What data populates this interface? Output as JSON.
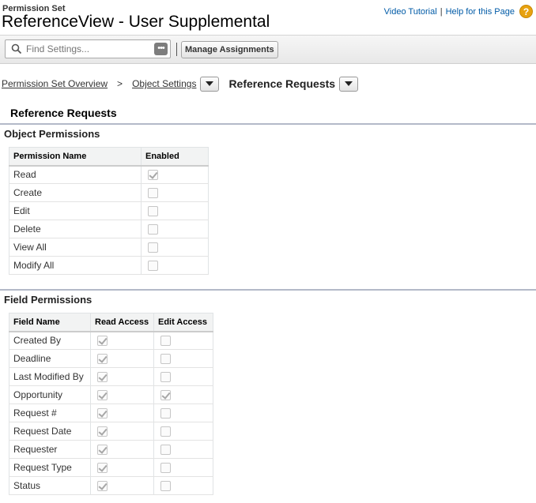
{
  "header": {
    "eyebrow": "Permission Set",
    "title": "ReferenceView - User Supplemental",
    "video_tutorial": "Video Tutorial",
    "separator": "|",
    "help_page": "Help for this Page",
    "help_icon": "question-icon"
  },
  "toolbar": {
    "search_placeholder": "Find Settings...",
    "manage_assignments": "Manage Assignments"
  },
  "breadcrumb": {
    "overview": "Permission Set Overview",
    "sep": ">",
    "object_settings": "Object Settings",
    "current": "Reference Requests"
  },
  "page_heading": "Reference Requests",
  "object_permissions": {
    "title": "Object Permissions",
    "columns": [
      "Permission Name",
      "Enabled"
    ],
    "rows": [
      {
        "name": "Read",
        "enabled": true
      },
      {
        "name": "Create",
        "enabled": false
      },
      {
        "name": "Edit",
        "enabled": false
      },
      {
        "name": "Delete",
        "enabled": false
      },
      {
        "name": "View All",
        "enabled": false
      },
      {
        "name": "Modify All",
        "enabled": false
      }
    ]
  },
  "field_permissions": {
    "title": "Field Permissions",
    "columns": [
      "Field Name",
      "Read Access",
      "Edit Access"
    ],
    "rows": [
      {
        "name": "Created By",
        "read": true,
        "edit": false
      },
      {
        "name": "Deadline",
        "read": true,
        "edit": false
      },
      {
        "name": "Last Modified By",
        "read": true,
        "edit": false
      },
      {
        "name": "Opportunity",
        "read": true,
        "edit": true
      },
      {
        "name": "Request #",
        "read": true,
        "edit": false
      },
      {
        "name": "Request Date",
        "read": true,
        "edit": false
      },
      {
        "name": "Requester",
        "read": true,
        "edit": false
      },
      {
        "name": "Request Type",
        "read": true,
        "edit": false
      },
      {
        "name": "Status",
        "read": true,
        "edit": false
      }
    ]
  },
  "colors": {
    "link": "#015ba7",
    "section_rule": "#b3b9c8",
    "help_icon": "#e8a20f"
  }
}
